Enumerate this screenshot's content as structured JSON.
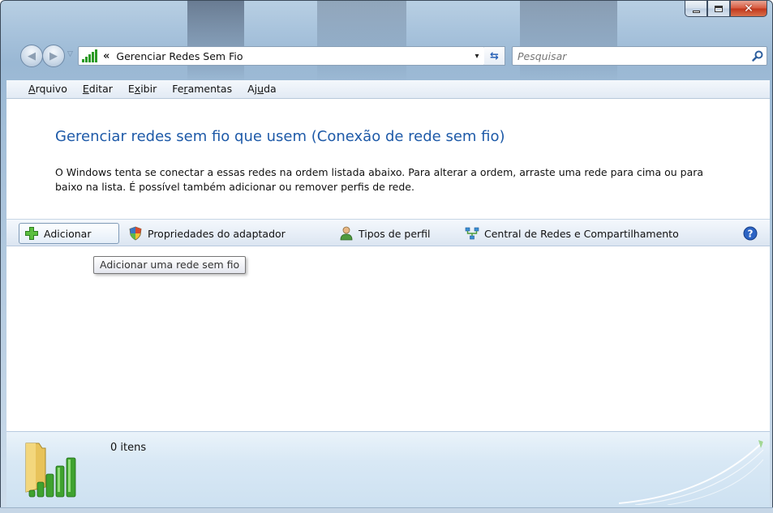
{
  "window": {
    "caption_buttons": [
      "minimize",
      "maximize",
      "close"
    ]
  },
  "address_bar": {
    "chevron": "«",
    "path": "Gerenciar Redes Sem Fio",
    "dropdown_glyph": "▾"
  },
  "search": {
    "placeholder": "Pesquisar"
  },
  "menu": {
    "items": [
      {
        "label": "Arquivo",
        "accel": "A",
        "rest": "rquivo",
        "pre": ""
      },
      {
        "label": "Editar",
        "accel": "E",
        "rest": "ditar",
        "pre": ""
      },
      {
        "label": "Exibir",
        "accel": "x",
        "rest": "ibir",
        "pre": "E"
      },
      {
        "label": "Ferramentas",
        "accel": "r",
        "rest": "amentas",
        "pre": "Fe"
      },
      {
        "label": "Ajuda",
        "accel": "u",
        "rest": "da",
        "pre": "Aj"
      }
    ]
  },
  "content": {
    "heading": "Gerenciar redes sem fio que usem (Conexão de rede sem fio)",
    "description": "O Windows tenta se conectar a essas redes na ordem listada abaixo. Para alterar a ordem, arraste uma rede para cima ou para baixo na lista. É possível também adicionar ou remover perfis de rede."
  },
  "commands": {
    "add": "Adicionar",
    "adapter_properties": "Propriedades do adaptador",
    "profile_types": "Tipos de perfil",
    "network_center": "Central de Redes e Compartilhamento"
  },
  "tooltip": {
    "text": "Adicionar uma rede sem fio"
  },
  "details": {
    "item_count": "0 itens"
  },
  "colors": {
    "heading": "#1e5aa8",
    "signal_green": "#2a9a23",
    "close_red": "#c1361b"
  },
  "icons": [
    "back-arrow-icon",
    "forward-arrow-icon",
    "wireless-signal-icon",
    "refresh-icon",
    "search-icon",
    "add-plus-icon",
    "shield-icon",
    "user-profile-icon",
    "network-center-icon",
    "help-icon"
  ]
}
